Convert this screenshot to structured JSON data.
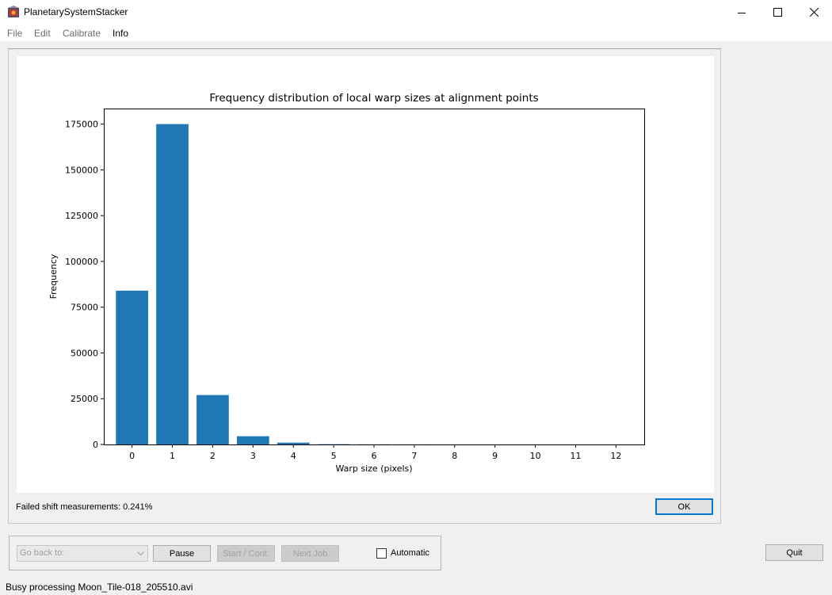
{
  "window": {
    "title": "PlanetarySystemStacker"
  },
  "menu": {
    "items": [
      "File",
      "Edit",
      "Calibrate",
      "Info"
    ]
  },
  "chart_data": {
    "type": "bar",
    "title": "Frequency distribution of local warp sizes at alignment points",
    "xlabel": "Warp size (pixels)",
    "ylabel": "Frequency",
    "categories": [
      "0",
      "1",
      "2",
      "3",
      "4",
      "5",
      "6",
      "7",
      "8",
      "9",
      "10",
      "11",
      "12"
    ],
    "values": [
      84000,
      175000,
      27000,
      4500,
      1000,
      150,
      50,
      20,
      10,
      5,
      3,
      2,
      1
    ],
    "yticks": [
      "0",
      "25000",
      "50000",
      "75000",
      "100000",
      "125000",
      "150000",
      "175000"
    ],
    "ylim": [
      0,
      183500
    ],
    "xlim": [
      -0.7,
      12.7
    ],
    "bar_color": "#1f77b4",
    "grid": false
  },
  "failed_text": "Failed shift measurements: 0.241%",
  "ok_label": "OK",
  "controls": {
    "goback_placeholder": "Go back to:",
    "pause_label": "Pause",
    "start_label": "Start / Cont.",
    "next_label": "Next Job",
    "automatic_label": "Automatic",
    "automatic_checked": false
  },
  "quit_label": "Quit",
  "status": "Busy processing Moon_Tile-018_205510.avi"
}
